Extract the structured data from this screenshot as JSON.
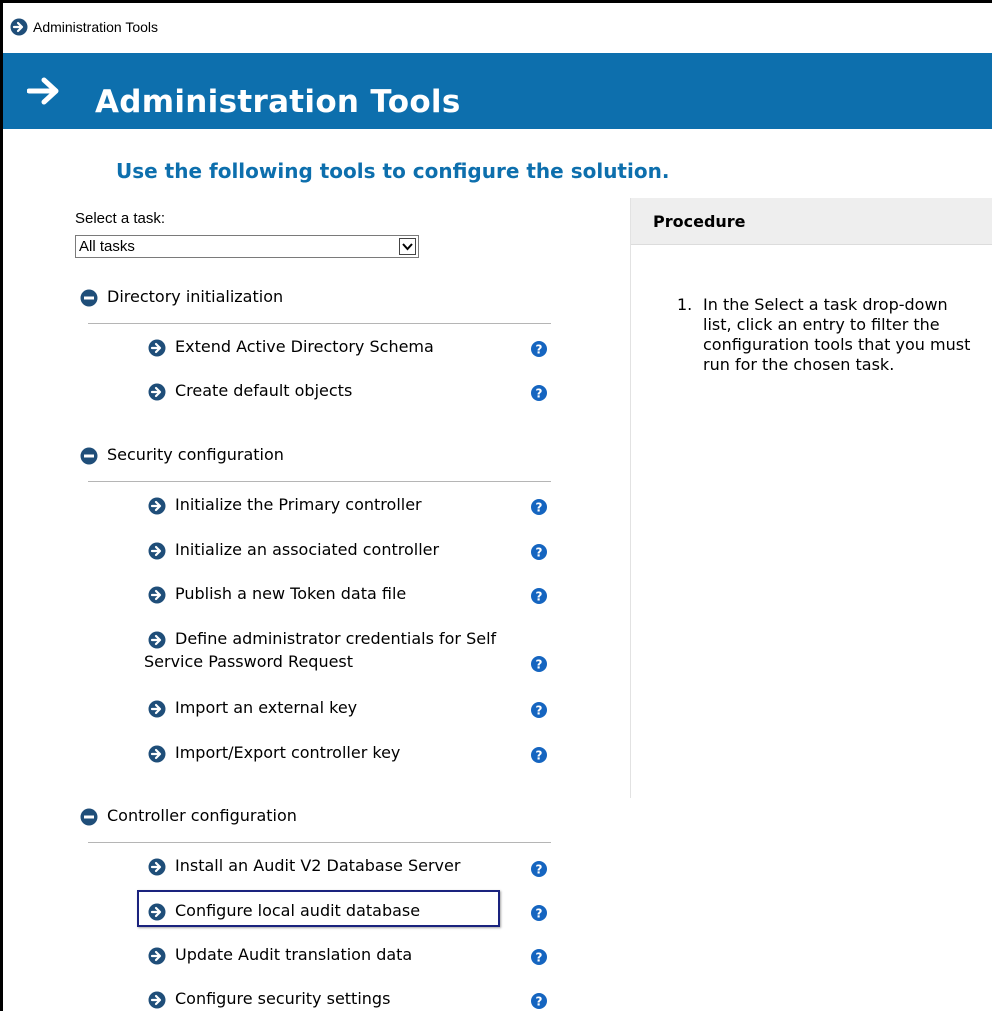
{
  "window": {
    "title": "Administration Tools",
    "icon": "arrow-circle-icon"
  },
  "banner": {
    "title": "Administration Tools",
    "icon": "arrow-right-icon",
    "color": "#0d6fad"
  },
  "subtitle": "Use the following tools to configure the solution.",
  "task_filter": {
    "label": "Select a task:",
    "selected": "All tasks"
  },
  "sections": [
    {
      "title": "Directory initialization",
      "tasks": [
        {
          "label": "Extend Active Directory Schema"
        },
        {
          "label": "Create default objects"
        }
      ]
    },
    {
      "title": "Security configuration",
      "tasks": [
        {
          "label": "Initialize the Primary controller"
        },
        {
          "label": "Initialize an associated controller"
        },
        {
          "label": "Publish a new Token data file"
        },
        {
          "label_line1": "Define administrator credentials for Self",
          "label_line2": "Service Password Request"
        },
        {
          "label": "Import an external key"
        },
        {
          "label": "Import/Export controller key"
        }
      ]
    },
    {
      "title": "Controller configuration",
      "tasks": [
        {
          "label": "Install an Audit V2 Database Server"
        },
        {
          "label": "Configure local audit database",
          "highlighted": true
        },
        {
          "label": "Update Audit translation data"
        },
        {
          "label": "Configure security settings"
        }
      ]
    }
  ],
  "procedure": {
    "title": "Procedure",
    "steps": [
      {
        "num": "1.",
        "text": "In the Select a task drop-down list, click an entry to filter the configuration tools that you must run for the chosen task."
      }
    ]
  },
  "colors": {
    "accent": "#0d6fad",
    "icon_dark": "#1f4e79",
    "help_blue": "#1565c0",
    "highlight_border": "#1a237e"
  }
}
